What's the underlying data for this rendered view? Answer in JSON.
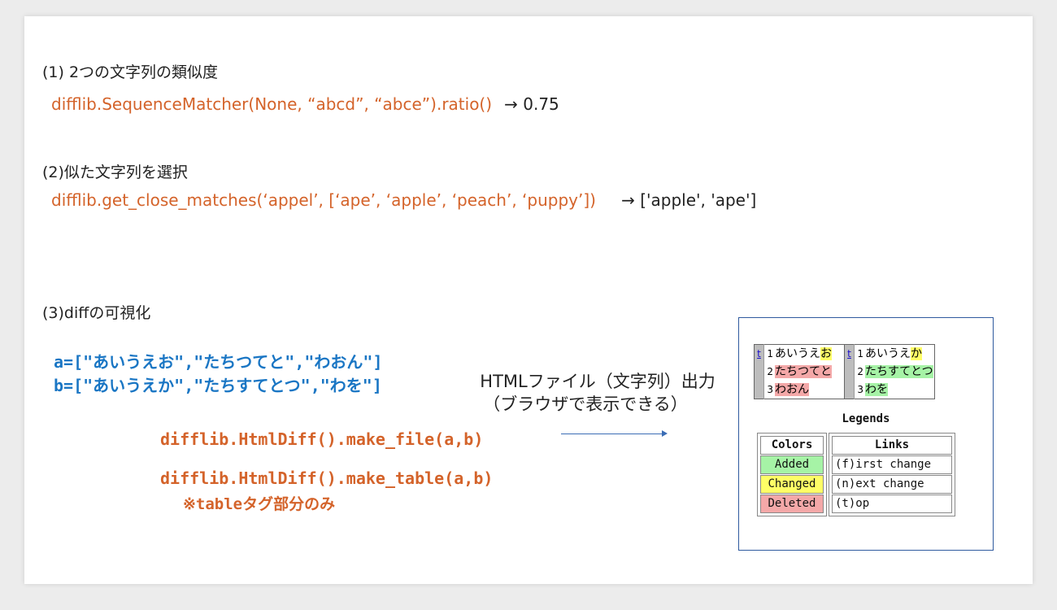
{
  "section1": {
    "heading": "(1) 2つの文字列の類似度",
    "code": "difflib.SequenceMatcher(None, “abcd”, “abce”).ratio()",
    "result": "→ 0.75"
  },
  "section2": {
    "heading": "(2)似た文字列を選択",
    "code": "difflib.get_close_matches(‘appel’, [‘ape’, ‘apple’, ‘peach’, ‘puppy’])",
    "result": "→ ['apple', 'ape']"
  },
  "section3": {
    "heading": "(3)diffの可視化",
    "var_a": "a=[\"あいうえお\",\"たちつてと\",\"わおん\"]",
    "var_b": "b=[\"あいうえか\",\"たちすてとつ\",\"わを\"]",
    "make_file": "difflib.HtmlDiff().make_file(a,b)",
    "make_table": "difflib.HtmlDiff().make_table(a,b)",
    "table_note": "※tableタグ部分のみ",
    "output_line1": "HTMLファイル（文字列）出力",
    "output_line2": "（ブラウザで表示できる）"
  },
  "preview": {
    "nav_link": "t",
    "rows": [
      {
        "num": "1",
        "left_plain": "あいうえ",
        "left_hl": "お",
        "right_plain": "あいうえ",
        "right_hl": "か"
      },
      {
        "num": "2",
        "left_hl": "たちつてと",
        "right_hl": "たちすてとつ"
      },
      {
        "num": "3",
        "left_hl": "わおん",
        "right_hl": "わを"
      }
    ],
    "legends_title": "Legends",
    "colors_header": "Colors",
    "colors": [
      "Added",
      "Changed",
      "Deleted"
    ],
    "links_header": "Links",
    "links": [
      "(f)irst change",
      "(n)ext change",
      "(t)op"
    ]
  },
  "colors": {
    "accent_orange": "#d4632a",
    "accent_blue": "#1a76c4",
    "added": "#a6f3a6",
    "changed": "#fffe66",
    "deleted": "#f4a8a8"
  }
}
